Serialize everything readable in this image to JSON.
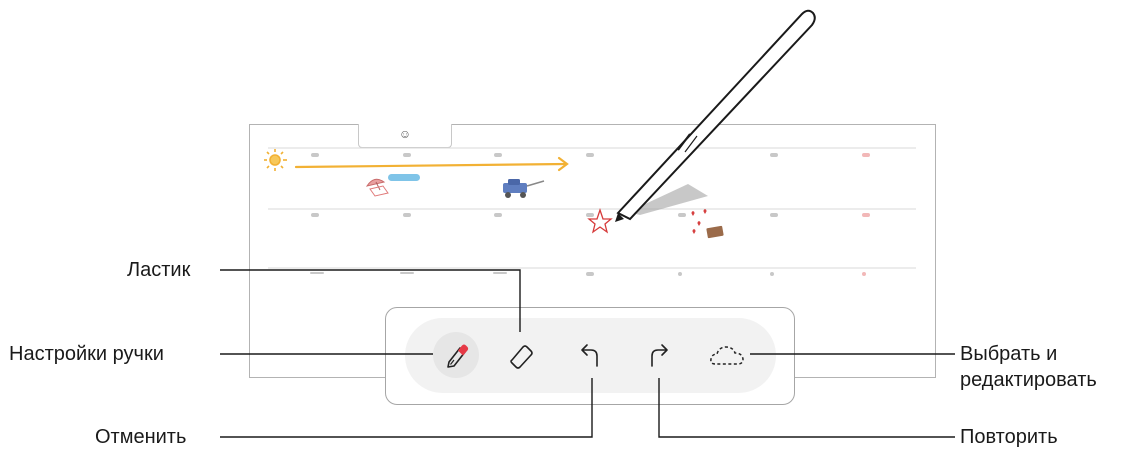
{
  "callouts": {
    "eraser": "Ластик",
    "pen_settings": "Настройки ручки",
    "undo": "Отменить",
    "select_edit_line1": "Выбрать и",
    "select_edit_line2": "редактировать",
    "redo": "Повторить"
  },
  "screen": {
    "tab_icon": "smiley-icon",
    "tab_glyph": "☺"
  },
  "toolbar": {
    "tools": [
      "pen-settings-icon",
      "eraser-icon",
      "undo-icon",
      "redo-icon",
      "lasso-select-icon"
    ],
    "pen_accent": "#e63946"
  },
  "colors": {
    "line": "#a6a6a6",
    "callout_line": "#1a1a1a",
    "arrow_orange": "#f2b134"
  }
}
